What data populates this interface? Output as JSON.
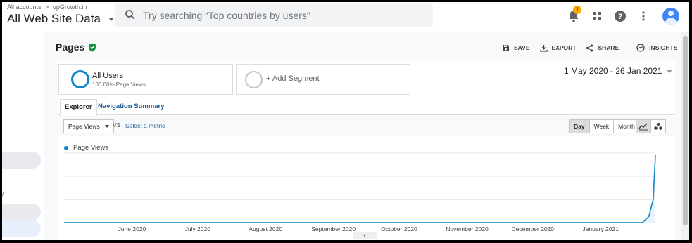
{
  "header": {
    "breadcrumb": [
      "All accounts",
      ">",
      "upGrowth.in"
    ],
    "property_title": "All Web Site Data",
    "search_placeholder": "Try searching “Top countries by users”",
    "notification_count": "1"
  },
  "page": {
    "title": "Pages",
    "actions": [
      {
        "label": "SAVE",
        "icon": "save-icon"
      },
      {
        "label": "EXPORT",
        "icon": "download-icon"
      },
      {
        "label": "SHARE",
        "icon": "share-icon"
      },
      {
        "label": "INSIGHTS",
        "icon": "insights-icon"
      }
    ]
  },
  "segments": {
    "primary_name": "All Users",
    "primary_sub": "100.00% Page Views",
    "add_label": "+ Add Segment"
  },
  "date_range": "1 May 2020 - 26 Jan 2021",
  "tabs": [
    "Explorer",
    "Navigation Summary"
  ],
  "toolbar": {
    "metric": "Page Views",
    "vs": "VS",
    "select_metric": "Select a metric",
    "granularity": [
      "Day",
      "Week",
      "Month"
    ],
    "active_granularity": "Day"
  },
  "colors": {
    "series": "#0f87c9",
    "accent": "#1a5a96"
  },
  "chart_data": {
    "type": "line",
    "series": [
      {
        "name": "Page Views"
      }
    ],
    "x_ticks": [
      "June 2020",
      "July 2020",
      "August 2020",
      "September 2020",
      "October 2020",
      "November 2020",
      "December 2020",
      "January 2021"
    ],
    "x_start": "2020-05-01",
    "x_end": "2021-01-26",
    "shape_note": "flat near zero through mid-January 2021, sharp spike in the final days",
    "values_relative": [
      {
        "date": "2020-05-01",
        "value": 0.01
      },
      {
        "date": "2020-07-01",
        "value": 0.01
      },
      {
        "date": "2020-09-01",
        "value": 0.01
      },
      {
        "date": "2020-11-01",
        "value": 0.01
      },
      {
        "date": "2021-01-20",
        "value": 0.01
      },
      {
        "date": "2021-01-23",
        "value": 0.1
      },
      {
        "date": "2021-01-25",
        "value": 0.35
      },
      {
        "date": "2021-01-26",
        "value": 1.0
      }
    ],
    "grid": true
  }
}
